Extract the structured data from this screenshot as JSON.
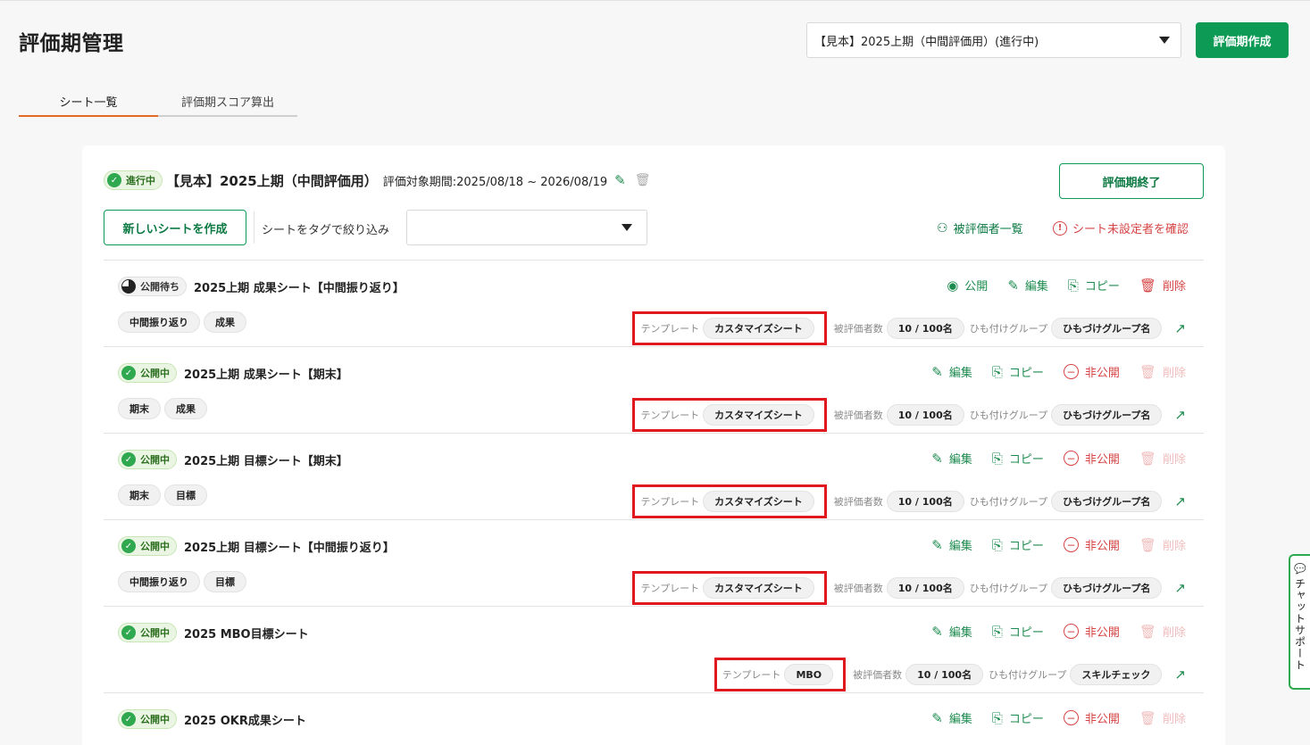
{
  "header": {
    "title": "評価期管理",
    "period_select": "【見本】2025上期（中間評価用）(進行中)",
    "create_button": "評価期作成"
  },
  "tabs": [
    {
      "label": "シート一覧"
    },
    {
      "label": "評価期スコア算出"
    }
  ],
  "period": {
    "status": "進行中",
    "name": "【見本】2025上期（中間評価用）",
    "range": "評価対象期間:2025/08/18 ~ 2026/08/19",
    "end_button": "評価期終了"
  },
  "toolbar": {
    "new_sheet": "新しいシートを作成",
    "filter_label": "シートをタグで絞り込み",
    "evaluatees_link": "被評価者一覧",
    "unset_link": "シート未設定者を確認"
  },
  "labels": {
    "template": "テンプレート",
    "evaluatee_count": "被評価者数",
    "group": "ひも付けグループ",
    "publish": "公開",
    "edit": "編集",
    "copy": "コピー",
    "delete": "削除",
    "unpublish": "非公開"
  },
  "sheets": [
    {
      "status": "公開待ち",
      "name": "2025上期 成果シート【中間振り返り】",
      "tags": [
        "中間振り返り",
        "成果"
      ],
      "template": "カスタマイズシート",
      "count": "10 / 100名",
      "group": "ひもづけグループ名"
    },
    {
      "status": "公開中",
      "name": "2025上期 成果シート【期末】",
      "tags": [
        "期末",
        "成果"
      ],
      "template": "カスタマイズシート",
      "count": "10 / 100名",
      "group": "ひもづけグループ名"
    },
    {
      "status": "公開中",
      "name": "2025上期 目標シート【期末】",
      "tags": [
        "期末",
        "目標"
      ],
      "template": "カスタマイズシート",
      "count": "10 / 100名",
      "group": "ひもづけグループ名"
    },
    {
      "status": "公開中",
      "name": "2025上期 目標シート【中間振り返り】",
      "tags": [
        "中間振り返り",
        "目標"
      ],
      "template": "カスタマイズシート",
      "count": "10 / 100名",
      "group": "ひもづけグループ名"
    },
    {
      "status": "公開中",
      "name": "2025 MBO目標シート",
      "tags": [],
      "template": "MBO",
      "count": "10 / 100名",
      "group": "スキルチェック"
    },
    {
      "status": "公開中",
      "name": "2025 OKR成果シート",
      "tags": [],
      "template": "",
      "count": "",
      "group": ""
    }
  ],
  "chat": {
    "label": "チャットサポート"
  }
}
